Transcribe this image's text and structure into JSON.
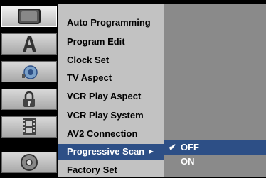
{
  "sidebar": {
    "items": [
      {
        "icon": "tv-screen-icon",
        "active": true
      },
      {
        "icon": "letter-a-icon",
        "active": false
      },
      {
        "icon": "speaker-icon",
        "active": false
      },
      {
        "icon": "lock-icon",
        "active": false
      },
      {
        "icon": "film-icon",
        "active": false
      },
      {
        "icon": "disc-icon",
        "active": false
      }
    ]
  },
  "menu": {
    "items": [
      {
        "label": "Auto Programming"
      },
      {
        "label": "Program Edit"
      },
      {
        "label": "Clock Set"
      },
      {
        "label": "TV Aspect"
      },
      {
        "label": "VCR Play Aspect"
      },
      {
        "label": "VCR Play System"
      },
      {
        "label": "AV2 Connection"
      },
      {
        "label": "Progressive Scan",
        "selected": true,
        "arrow": "►"
      },
      {
        "label": "Factory Set"
      }
    ]
  },
  "submenu": {
    "items": [
      {
        "label": "OFF",
        "checked": true,
        "check": "✔"
      },
      {
        "label": "ON",
        "checked": false
      }
    ]
  },
  "colors": {
    "highlight": "#2d4f86",
    "menu_bg": "#c2c2c2",
    "submenu_bg": "#8a8a8a"
  }
}
